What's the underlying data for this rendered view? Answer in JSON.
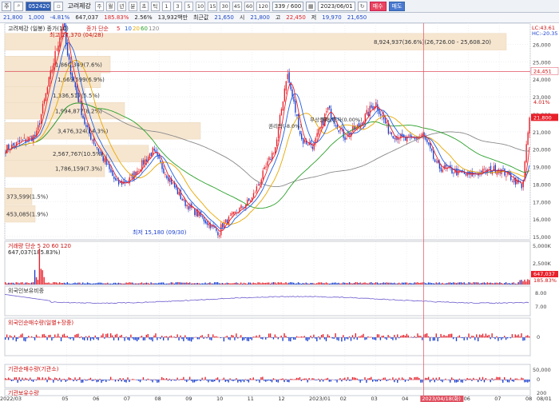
{
  "toolbar": {
    "chart_type_label": "주",
    "stock_code": "052420",
    "stock_name": "고려제강",
    "periods": [
      "주",
      "월",
      "년",
      "분",
      "초",
      "틱"
    ],
    "intervals": [
      "1",
      "3",
      "5",
      "10",
      "15",
      "30",
      "45",
      "60",
      "120"
    ],
    "count": "339 / 600",
    "date": "2023/06/01",
    "buy_label": "매수",
    "sell_label": "매도"
  },
  "info": {
    "price": "21,800",
    "change": "1,000",
    "change_pct": "-4.81%",
    "volume": "647,037",
    "volume_pct": "185.83%",
    "turnover": "2.56%",
    "amount": "13,932백만",
    "label_recent": "최근값",
    "recent": "21,650",
    "open_label": "시",
    "open": "21,800",
    "high_label": "고",
    "high": "22,450",
    "low_label": "저",
    "low": "19,970",
    "close_raw": "21,650"
  },
  "main_panel": {
    "legend_title": "고려제강 (일봉) 종가(10)",
    "ma_label": "종가 단순",
    "ma_periods": [
      "5",
      "10",
      "20",
      "60",
      "120"
    ],
    "y_ticks": [
      "26,000",
      "25,000",
      "24,000",
      "23,000",
      "22,000",
      "21,000",
      "20,000",
      "19,000",
      "18,000",
      "17,000",
      "16,000",
      "15,000"
    ],
    "right_top_labels": [
      "LC:43.61",
      "HC:-20.35"
    ],
    "current_price_tag": "21,800",
    "hline_tag": "24,451",
    "pct_tag": "4.01%",
    "high_annotation": "최고 27,370 (04/28)",
    "low_annotation": "최저 15,180 (09/30)",
    "volume_profile": [
      "8,924,937(36.6%)(26,726.00 - 25,608.20)",
      "1,860,349(7.6%)",
      "1,669,599(6.9%)",
      "1,336,517(5.5%)",
      "1,994,877(8.2%)",
      "3,476,324(14.3%)",
      "2,567,767(10.5%)",
      "1,786,159(7.3%)",
      "373,599(1.5%)",
      "453,085(1.9%)"
    ],
    "signals": [
      "무상증자",
      "무상증자(0.00%)",
      "권리락(-8.0%)"
    ]
  },
  "volume_panel": {
    "title": "거래량 단순 5 20 60 120",
    "value": "647,037(185.83%)",
    "y_ticks": [
      "2,500K",
      "5,000K"
    ],
    "tag_value": "647,037",
    "tag_pct": "185.83%"
  },
  "foreign_panel": {
    "title": "외국인보유비중",
    "y_ticks": [
      "8.00",
      "7.00"
    ]
  },
  "foreign_net_panel": {
    "title": "외국인순매수량(일별+장중)",
    "y_ticks": [
      "0"
    ]
  },
  "inst_net_panel": {
    "title": "기관순매수량(기관소)",
    "y_ticks": [
      "50,000",
      "0"
    ]
  },
  "inst_hold_panel": {
    "title": "기관보유수량",
    "y_ticks": [
      "200"
    ]
  },
  "x_axis": {
    "labels": [
      "2022/03",
      "05",
      "06",
      "07",
      "08",
      "09",
      "10",
      "11",
      "12",
      "2023/01",
      "02",
      "03",
      "04",
      "05",
      "06",
      "07",
      "08"
    ],
    "highlight_date": "2023/04/18(화)",
    "end_date": "08/01"
  },
  "chart_data": {
    "type": "candlestick",
    "x_start": "2022/03",
    "x_end": "2023/08/01",
    "ylim": [
      15000,
      26800
    ],
    "close_keyframes": [
      {
        "date": "2022/03",
        "value": 20000
      },
      {
        "date": "2022/04",
        "value": 20800
      },
      {
        "date": "2022/04/28",
        "value": 27370
      },
      {
        "date": "2022/05",
        "value": 25300
      },
      {
        "date": "2022/05/20",
        "value": 21200
      },
      {
        "date": "2022/06",
        "value": 20000
      },
      {
        "date": "2022/06/20",
        "value": 18000
      },
      {
        "date": "2022/07",
        "value": 18200
      },
      {
        "date": "2022/07/25",
        "value": 19900
      },
      {
        "date": "2022/08",
        "value": 19200
      },
      {
        "date": "2022/08/25",
        "value": 17000
      },
      {
        "date": "2022/09/30",
        "value": 15180
      },
      {
        "date": "2022/10",
        "value": 15600
      },
      {
        "date": "2022/11",
        "value": 17200
      },
      {
        "date": "2022/11/25",
        "value": 20200
      },
      {
        "date": "2022/12/05",
        "value": 24400
      },
      {
        "date": "2022/12/20",
        "value": 20500
      },
      {
        "date": "2023/01",
        "value": 20200
      },
      {
        "date": "2023/01/15",
        "value": 22300
      },
      {
        "date": "2023/02",
        "value": 20700
      },
      {
        "date": "2023/02/15",
        "value": 21300
      },
      {
        "date": "2023/03",
        "value": 22700
      },
      {
        "date": "2023/03/15",
        "value": 21000
      },
      {
        "date": "2023/04",
        "value": 20500
      },
      {
        "date": "2023/04/18",
        "value": 20800
      },
      {
        "date": "2023/05",
        "value": 19000
      },
      {
        "date": "2023/06",
        "value": 18500
      },
      {
        "date": "2023/07",
        "value": 18900
      },
      {
        "date": "2023/07/25",
        "value": 17900
      },
      {
        "date": "2023/08/01",
        "value": 21800
      }
    ]
  },
  "colors": {
    "up": "#e8202a",
    "down": "#1a3fd0",
    "ma5": "#e8202a",
    "ma10": "#1f5fe0",
    "ma20": "#e8a800",
    "ma60": "#2aa02a",
    "ma120": "#8a8a8a",
    "profile": "#f6e6d0"
  }
}
